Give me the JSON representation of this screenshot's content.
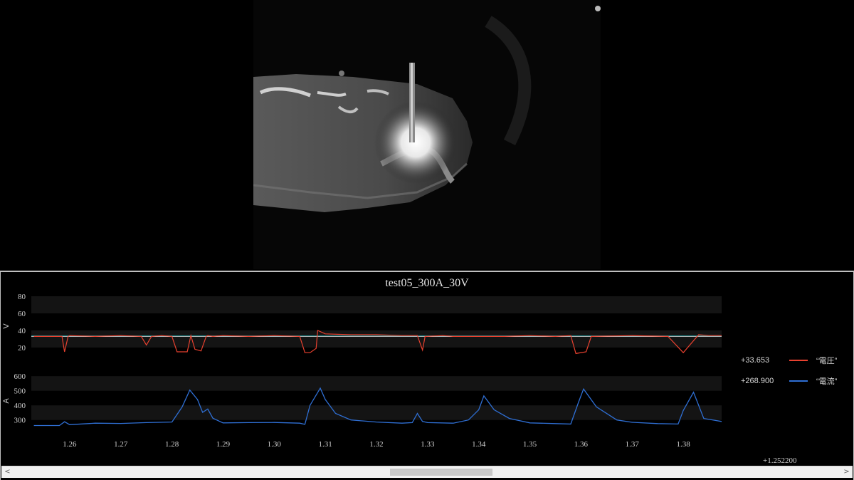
{
  "plot": {
    "title": "test05_300A_30V",
    "x_offset_label": "+1.252200"
  },
  "legend": [
    {
      "value": "+33.653",
      "name": "“電圧”",
      "color": "#e8412f"
    },
    {
      "value": "+268.900",
      "name": "“電流”",
      "color": "#2f6fd4"
    }
  ],
  "chart_data": [
    {
      "type": "line",
      "title": "test05_300A_30V",
      "ylabel": "V",
      "ylim": [
        10,
        80
      ],
      "yticks": [
        20,
        40,
        60,
        80
      ],
      "xlim": [
        1.2525,
        1.3875
      ],
      "xticks": [
        1.26,
        1.27,
        1.28,
        1.29,
        1.3,
        1.31,
        1.32,
        1.33,
        1.34,
        1.35,
        1.36,
        1.37,
        1.38
      ],
      "reference_line": 33.653,
      "series": [
        {
          "name": "“電圧”",
          "color": "#e8412f",
          "x": [
            1.253,
            1.2585,
            1.259,
            1.2597,
            1.26,
            1.265,
            1.27,
            1.274,
            1.275,
            1.276,
            1.278,
            1.28,
            1.281,
            1.283,
            1.2837,
            1.2845,
            1.2857,
            1.2867,
            1.287,
            1.288,
            1.29,
            1.295,
            1.3,
            1.305,
            1.306,
            1.307,
            1.3082,
            1.3085,
            1.31,
            1.315,
            1.32,
            1.325,
            1.328,
            1.329,
            1.3295,
            1.333,
            1.335,
            1.34,
            1.342,
            1.345,
            1.35,
            1.355,
            1.358,
            1.359,
            1.361,
            1.362,
            1.37,
            1.377,
            1.38,
            1.383,
            1.385,
            1.3875
          ],
          "y": [
            33,
            33,
            15,
            33,
            34,
            33,
            34,
            33,
            23,
            33,
            34,
            33,
            15,
            15,
            34,
            18,
            16,
            33,
            34,
            33,
            34,
            33,
            34,
            33,
            14,
            14,
            19,
            40,
            36,
            35,
            35,
            34,
            34,
            17,
            33,
            34,
            33,
            33,
            33,
            33,
            34,
            33,
            34,
            13,
            15,
            33,
            34,
            33,
            14,
            35,
            34,
            34
          ]
        },
        {
          "name": "“電流”",
          "color": "#2f6fd4",
          "ylabel": "A",
          "ylim": [
            240,
            640
          ],
          "yticks": [
            300,
            400,
            500,
            600
          ],
          "x": [
            1.253,
            1.258,
            1.259,
            1.26,
            1.265,
            1.27,
            1.275,
            1.28,
            1.282,
            1.2835,
            1.285,
            1.286,
            1.287,
            1.288,
            1.29,
            1.295,
            1.3,
            1.305,
            1.306,
            1.307,
            1.309,
            1.31,
            1.312,
            1.315,
            1.32,
            1.325,
            1.327,
            1.328,
            1.329,
            1.33,
            1.335,
            1.338,
            1.34,
            1.341,
            1.343,
            1.346,
            1.35,
            1.355,
            1.358,
            1.3595,
            1.3605,
            1.363,
            1.367,
            1.37,
            1.375,
            1.379,
            1.38,
            1.382,
            1.384,
            1.3875
          ],
          "y": [
            262,
            262,
            288,
            268,
            278,
            276,
            282,
            286,
            390,
            505,
            440,
            352,
            375,
            312,
            280,
            282,
            283,
            278,
            270,
            400,
            518,
            440,
            345,
            300,
            286,
            278,
            282,
            345,
            290,
            282,
            278,
            300,
            370,
            465,
            370,
            310,
            280,
            275,
            272,
            420,
            512,
            390,
            300,
            284,
            275,
            272,
            365,
            490,
            310,
            290
          ]
        }
      ]
    }
  ]
}
